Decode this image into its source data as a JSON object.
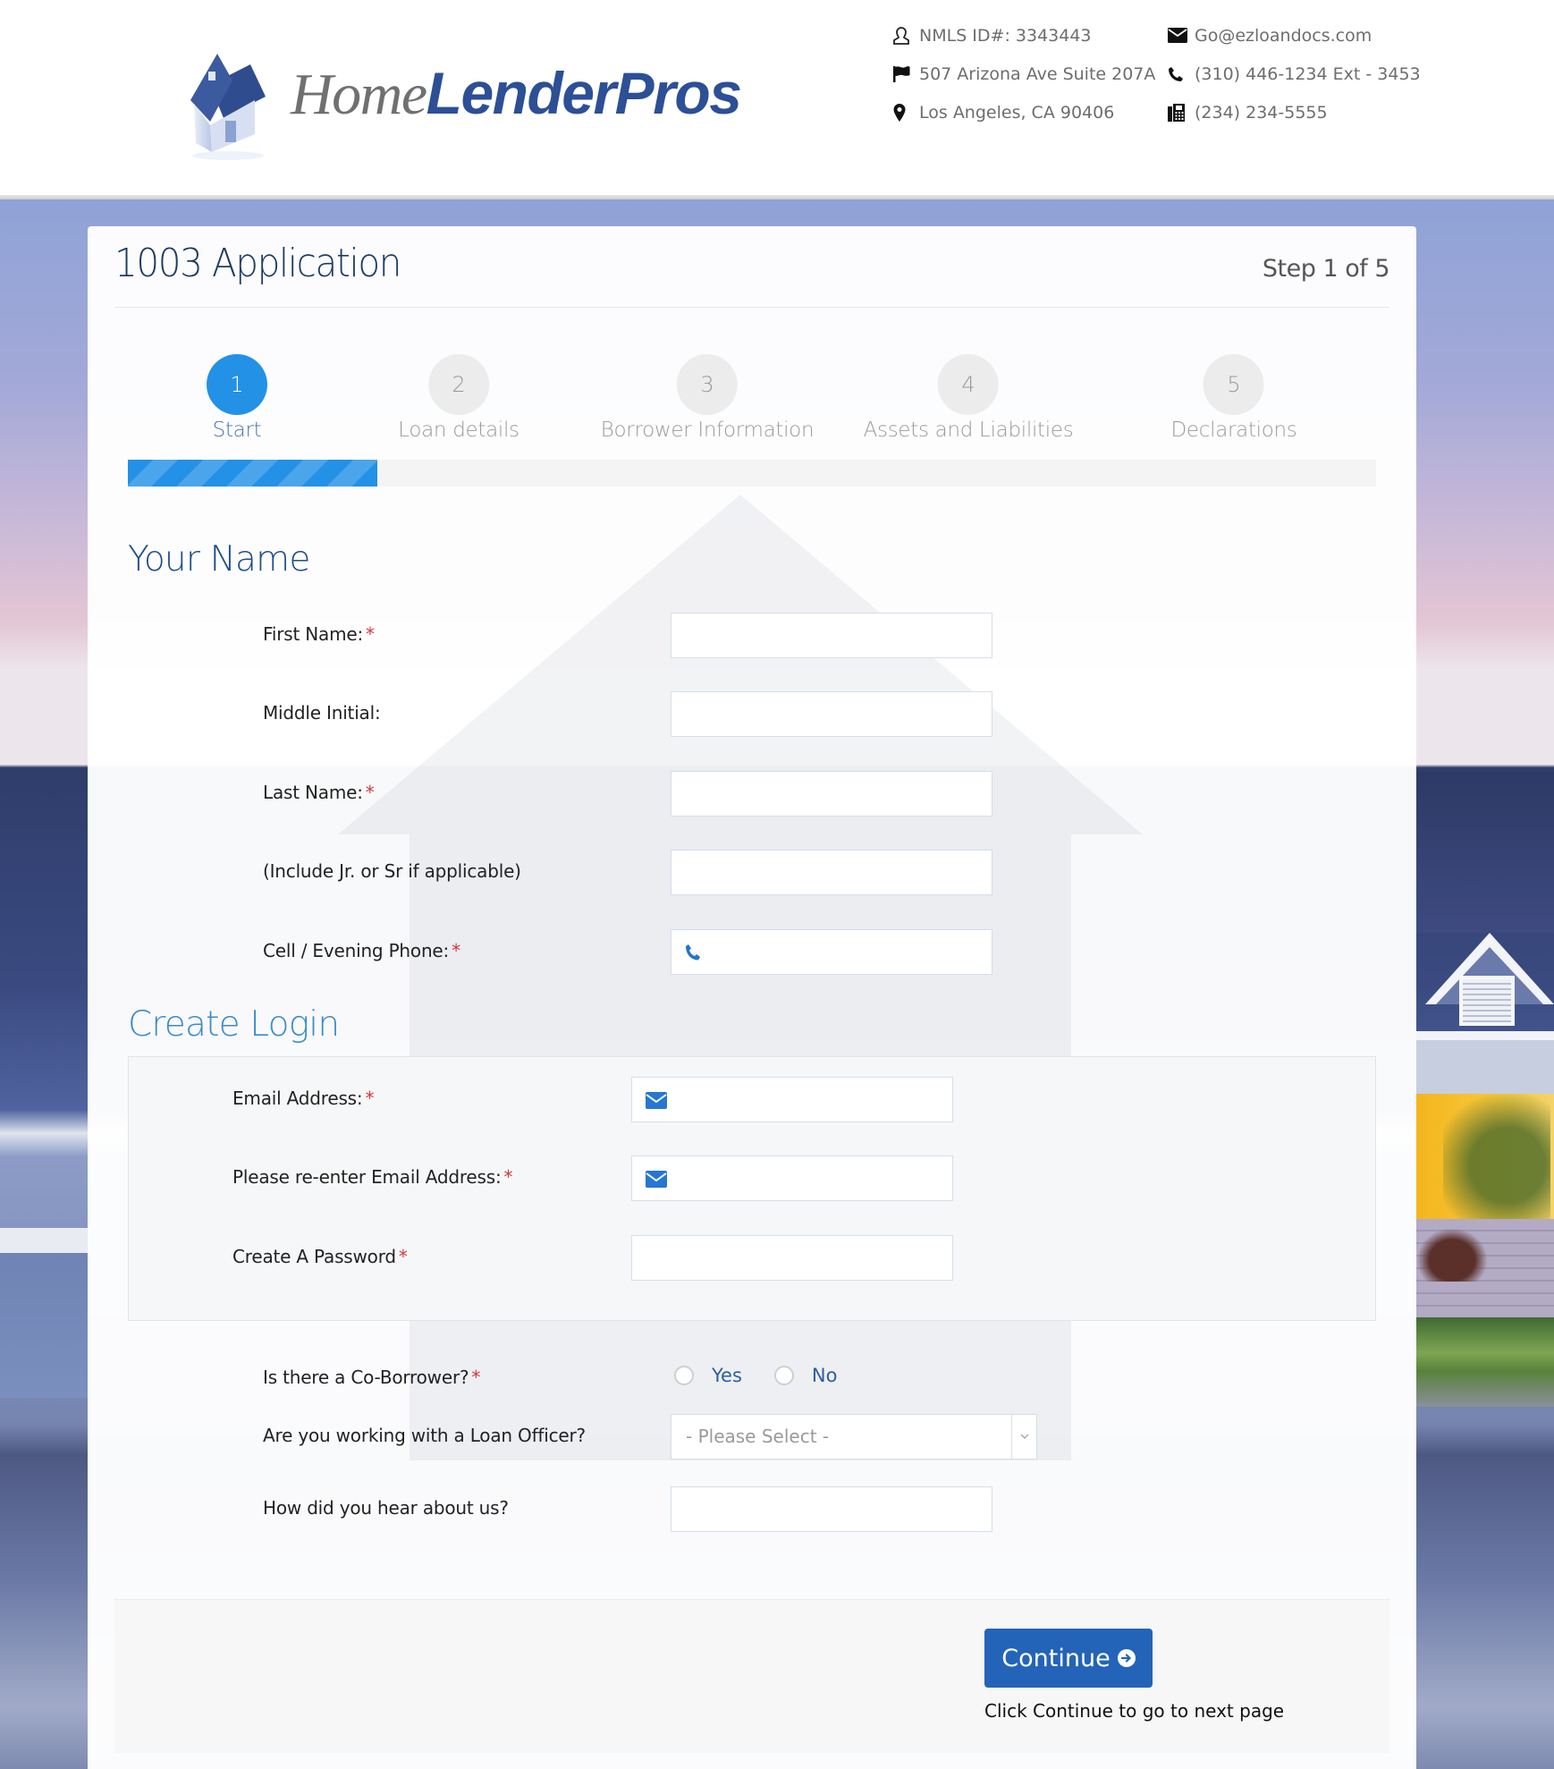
{
  "brand": {
    "name_part1": "Home",
    "name_part2": "LenderPros",
    "logo_icon": "house-icon",
    "primary_color": "#2c4f96",
    "accent_color": "#2391e6",
    "button_color": "#2364b8"
  },
  "contact": {
    "left": [
      {
        "icon": "user-icon",
        "text": "NMLS ID#: 3343443"
      },
      {
        "icon": "flag-icon",
        "text": "507 Arizona Ave Suite 207A"
      },
      {
        "icon": "map-marker-icon",
        "text": "Los Angeles, CA 90406"
      }
    ],
    "right": [
      {
        "icon": "envelope-icon",
        "text": "Go@ezloandocs.com"
      },
      {
        "icon": "phone-icon",
        "text": "(310) 446-1234 Ext - 3453"
      },
      {
        "icon": "fax-icon",
        "text": "(234) 234-5555"
      }
    ]
  },
  "application": {
    "title": "1003 Application",
    "step_indicator": "Step 1 of 5",
    "current_step": 1,
    "total_steps": 5,
    "progress_percent": 20,
    "steps": [
      {
        "number": "1",
        "label": "Start",
        "active": true
      },
      {
        "number": "2",
        "label": "Loan details",
        "active": false
      },
      {
        "number": "3",
        "label": "Borrower Information",
        "active": false
      },
      {
        "number": "4",
        "label": "Assets and Liabilities",
        "active": false
      },
      {
        "number": "5",
        "label": "Declarations",
        "active": false
      }
    ]
  },
  "your_name": {
    "section_title": "Your Name",
    "fields": [
      {
        "label": "First Name:",
        "required": true,
        "value": "",
        "icon": null
      },
      {
        "label": "Middle Initial:",
        "required": false,
        "value": "",
        "icon": null
      },
      {
        "label": "Last Name:",
        "required": true,
        "value": "",
        "icon": null
      },
      {
        "label": "(Include Jr. or Sr if applicable)",
        "required": false,
        "value": "",
        "icon": null
      },
      {
        "label": "Cell / Evening Phone:",
        "required": true,
        "value": "",
        "icon": "phone-icon"
      }
    ]
  },
  "create_login": {
    "section_title": "Create Login",
    "fields": [
      {
        "label": "Email Address:",
        "required": true,
        "value": "",
        "icon": "envelope-icon"
      },
      {
        "label": "Please re-enter Email Address:",
        "required": true,
        "value": "",
        "icon": "envelope-icon"
      },
      {
        "label": "Create A Password",
        "required": true,
        "value": "",
        "icon": null
      }
    ]
  },
  "extra": {
    "co_borrower": {
      "label": "Is there a Co-Borrower?",
      "required": true,
      "options": [
        "Yes",
        "No"
      ],
      "selected": null
    },
    "loan_officer": {
      "label": "Are you working with a Loan Officer?",
      "selected": "- Please Select -"
    },
    "hear_about": {
      "label": "How did you hear about us?",
      "value": ""
    }
  },
  "footer": {
    "continue_label": "Continue",
    "continue_note": "Click Continue to go to next page"
  },
  "required_mark": "*"
}
